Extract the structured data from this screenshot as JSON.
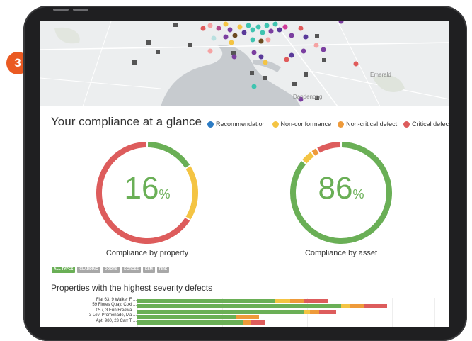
{
  "step_badge": "3",
  "map": {
    "place_labels": [
      "Emerald",
      "Dandenong"
    ]
  },
  "colors": {
    "green": "#6aaf56",
    "yellow": "#f4c443",
    "orange": "#ee9a3a",
    "red": "#dd5c5c",
    "blue": "#2d7cc4"
  },
  "header": {
    "title": "Your compliance at a glance"
  },
  "legend": [
    {
      "label": "Recommendation",
      "color": "#2d7cc4"
    },
    {
      "label": "Non-conformance",
      "color": "#f4c443"
    },
    {
      "label": "Non-critical defect",
      "color": "#ee9a3a"
    },
    {
      "label": "Critical defect",
      "color": "#dd5c5c"
    }
  ],
  "gauges": [
    {
      "value": "16",
      "unit": "%",
      "label": "Compliance by property",
      "segments": [
        {
          "color": "#6aaf56",
          "fraction": 0.16
        },
        {
          "color": "#f4c443",
          "fraction": 0.18
        },
        {
          "color": "#dd5c5c",
          "fraction": 0.66
        }
      ]
    },
    {
      "value": "86",
      "unit": "%",
      "label": "Compliance by asset",
      "segments": [
        {
          "color": "#6aaf56",
          "fraction": 0.86
        },
        {
          "color": "#f4c443",
          "fraction": 0.04
        },
        {
          "color": "#ee9a3a",
          "fraction": 0.02
        },
        {
          "color": "#dd5c5c",
          "fraction": 0.08
        }
      ]
    }
  ],
  "filters": [
    "ALL TYPES",
    "CLADDING",
    "DOORS",
    "EGRESS",
    "ESM",
    "FIRE"
  ],
  "severity_section": {
    "title": "Properties with the highest severity defects",
    "rows": [
      {
        "label": "Flat 63, 9 Walker F ...",
        "segments": [
          {
            "color": "#6aaf56",
            "value": 194
          },
          {
            "color": "#f4c443",
            "value": 22
          },
          {
            "color": "#ee9a3a",
            "value": 20
          },
          {
            "color": "#dd5c5c",
            "value": 33
          }
        ]
      },
      {
        "label": "59 Flores Quay, Coxl ...",
        "segments": [
          {
            "color": "#6aaf56",
            "value": 288
          },
          {
            "color": "#f4c443",
            "value": 13
          },
          {
            "color": "#ee9a3a",
            "value": 20
          },
          {
            "color": "#dd5c5c",
            "value": 32
          }
        ]
      },
      {
        "label": "05 /, 3 Erin Freewa ...",
        "segments": [
          {
            "color": "#6aaf56",
            "value": 236
          },
          {
            "color": "#f4c443",
            "value": 8
          },
          {
            "color": "#ee9a3a",
            "value": 13
          },
          {
            "color": "#dd5c5c",
            "value": 24
          }
        ]
      },
      {
        "label": "3 Levi Promenade, Ma ...",
        "segments": [
          {
            "color": "#6aaf56",
            "value": 139
          },
          {
            "color": "#ee9a3a",
            "value": 33
          },
          {
            "color": "#dd5c5c",
            "value": 0
          }
        ]
      },
      {
        "label": "Apt. 980, 23 Carr T ...",
        "segments": [
          {
            "color": "#6aaf56",
            "value": 150
          },
          {
            "color": "#ee9a3a",
            "value": 10
          },
          {
            "color": "#dd5c5c",
            "value": 20
          }
        ]
      }
    ],
    "max_value": 420
  }
}
